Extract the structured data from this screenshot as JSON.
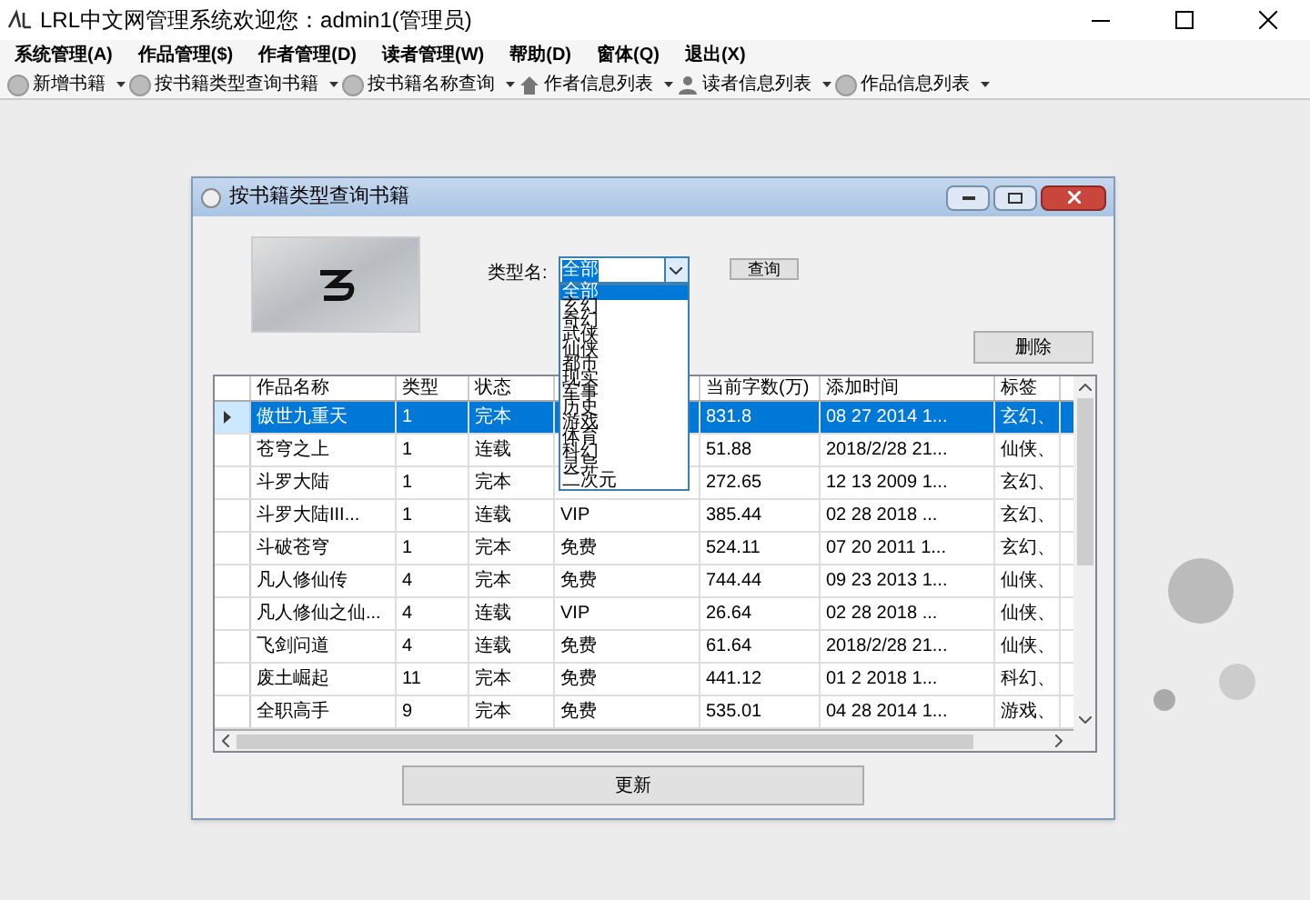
{
  "window": {
    "title": "LRL中文网管理系统欢迎您：admin1(管理员)"
  },
  "menu": [
    "系统管理(A)",
    "作品管理($)",
    "作者管理(D)",
    "读者管理(W)",
    "帮助(D)",
    "窗体(Q)",
    "退出(X)"
  ],
  "toolbar": [
    {
      "label": "新增书籍",
      "kind": "circle"
    },
    {
      "label": "按书籍类型查询书籍",
      "kind": "circle"
    },
    {
      "label": "按书籍名称查询",
      "kind": "circle"
    },
    {
      "label": "作者信息列表",
      "kind": "house"
    },
    {
      "label": "读者信息列表",
      "kind": "person"
    },
    {
      "label": "作品信息列表",
      "kind": "circle"
    }
  ],
  "child_window": {
    "title": "按书籍类型查询书籍",
    "type_label": "类型名:",
    "type_value": "全部",
    "query_button": "查询",
    "delete_button": "删除",
    "refresh_button": "更新",
    "dropdown": [
      {
        "label": "全部",
        "selected": true
      },
      {
        "label": "玄幻",
        "selected": false
      },
      {
        "label": "奇幻",
        "selected": false
      },
      {
        "label": "武侠",
        "selected": false
      },
      {
        "label": "仙侠",
        "selected": false
      },
      {
        "label": "都市",
        "selected": false
      },
      {
        "label": "现实",
        "selected": false
      },
      {
        "label": "军事",
        "selected": false
      },
      {
        "label": "历史",
        "selected": false
      },
      {
        "label": "游戏",
        "selected": false
      },
      {
        "label": "体育",
        "selected": false
      },
      {
        "label": "科幻",
        "selected": false
      },
      {
        "label": "灵异",
        "selected": false
      },
      {
        "label": "二次元",
        "selected": false
      }
    ],
    "table": {
      "columns": [
        "作品名称",
        "类型",
        "状态",
        null,
        "当前字数(万)",
        "添加时间",
        "标签"
      ],
      "rows": [
        {
          "selected": true,
          "cells": [
            "傲世九重天",
            "1",
            "完本",
            null,
            "831.8",
            "08 27 2014 1...",
            "玄幻、"
          ]
        },
        {
          "selected": false,
          "cells": [
            "苍穹之上",
            "1",
            "连载",
            null,
            "51.88",
            "2018/2/28 21...",
            "仙侠、"
          ]
        },
        {
          "selected": false,
          "cells": [
            "斗罗大陆",
            "1",
            "完本",
            null,
            "272.65",
            "12 13 2009 1...",
            "玄幻、"
          ]
        },
        {
          "selected": false,
          "cells": [
            "斗罗大陆III...",
            "1",
            "连载",
            "VIP",
            "385.44",
            "02 28 2018  ...",
            "玄幻、"
          ]
        },
        {
          "selected": false,
          "cells": [
            "斗破苍穹",
            "1",
            "完本",
            "免费",
            "524.11",
            "07 20 2011 1...",
            "玄幻、"
          ]
        },
        {
          "selected": false,
          "cells": [
            "凡人修仙传",
            "4",
            "完本",
            "免费",
            "744.44",
            "09 23 2013 1...",
            "仙侠、"
          ]
        },
        {
          "selected": false,
          "cells": [
            "凡人修仙之仙...",
            "4",
            "连载",
            "VIP",
            "26.64",
            "02 28 2018  ...",
            "仙侠、"
          ]
        },
        {
          "selected": false,
          "cells": [
            "飞剑问道",
            "4",
            "连载",
            "免费",
            "61.64",
            "2018/2/28 21...",
            "仙侠、"
          ]
        },
        {
          "selected": false,
          "cells": [
            "废土崛起",
            "11",
            "完本",
            "免费",
            "441.12",
            "01  2 2018 1...",
            "科幻、"
          ]
        },
        {
          "selected": false,
          "cells": [
            "全职高手",
            "9",
            "完本",
            "免费",
            "535.01",
            "04 28 2014 1...",
            "游戏、"
          ]
        }
      ]
    }
  }
}
